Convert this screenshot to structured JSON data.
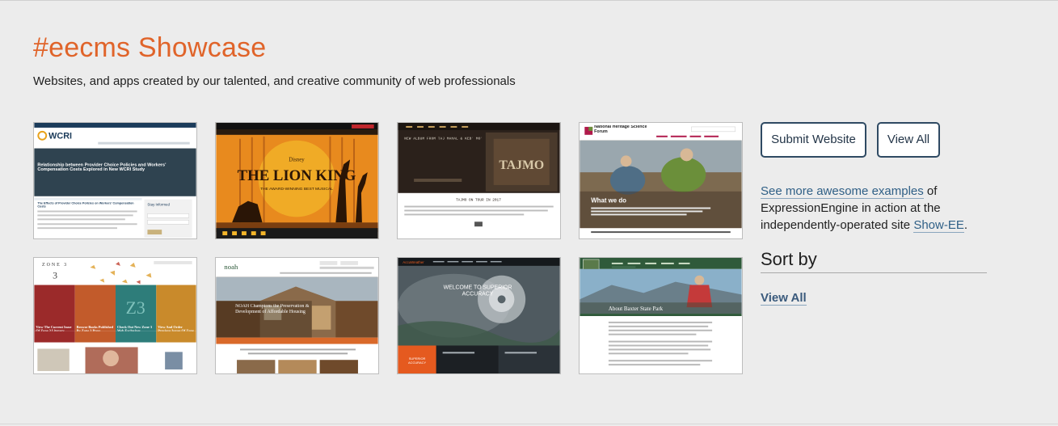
{
  "header": {
    "title": "#eecms Showcase",
    "subtitle": "Websites, and apps created by our talented, and creative community of web professionals"
  },
  "actions": {
    "submit_label": "Submit Website",
    "view_all_label": "View All"
  },
  "info": {
    "link_text": "See more awesome examples",
    "text_middle": " of ExpressionEngine in action at the independently-operated site ",
    "site_link": "Show-EE",
    "text_end": "."
  },
  "sort": {
    "title": "Sort by",
    "view_all": "View All"
  },
  "showcase": [
    {
      "site": "WCRI",
      "headline": "Relationship between Provider Choice Policies and Workers' Compensation Costs Explored in New WCRI Study",
      "article": "The Effects of Provider Choice Policies on Workers' Compensation Costs",
      "sidebar": "Stay Informed",
      "colors": {
        "bar": "#1b3b5a",
        "hero": "#3a4f5c",
        "accent": "#e8a21b"
      }
    },
    {
      "site": "THE LION KING",
      "tagline": "THE AWARD-WINNING BEST MUSICAL",
      "brand": "Disney",
      "colors": {
        "bg": "#e88a1e",
        "sun": "#f3b52a",
        "ground": "#7a3e10"
      }
    },
    {
      "site": "TAJMO",
      "headline": "NEW ALBUM FROM TAJ MAHAL & KEB' MO'",
      "section": "TAJMO ON TOUR IN 2017",
      "colors": {
        "bg": "#2b211b",
        "accent": "#c9a25e"
      }
    },
    {
      "site": "National Heritage Science Forum",
      "section": "What we do",
      "colors": {
        "accent": "#b01a4b",
        "green": "#6b8f3a"
      }
    },
    {
      "site": "ZONE 3",
      "sections": [
        "View The Current Issue Of Zone 3 Literary Journal",
        "Browse Books Published By Zone 3 Press",
        "Check Out New Zone 3 Web Exclusives",
        "View And Order Previous Issues Of Zone 3"
      ],
      "colors": {
        "a": "#9b2a2a",
        "b": "#c25b2b",
        "c": "#2e7d7a",
        "d": "#c98a2b"
      }
    },
    {
      "site": "noah",
      "headline": "NOAH Champions the Preservation & Development of Affordable Housing",
      "colors": {
        "brown": "#6f4a2b",
        "orange": "#d9692a"
      }
    },
    {
      "site": "AccuWeather",
      "headline": "WELCOME TO SUPERIOR ACCURACY",
      "cta": "SUPERIOR ACCURACY",
      "colors": {
        "dark": "#22272b",
        "orange": "#e55a1f"
      }
    },
    {
      "site": "Baxter State Park",
      "headline": "About Baxter State Park",
      "colors": {
        "green": "#2f5a3a",
        "sky": "#8ab0c9"
      }
    }
  ]
}
